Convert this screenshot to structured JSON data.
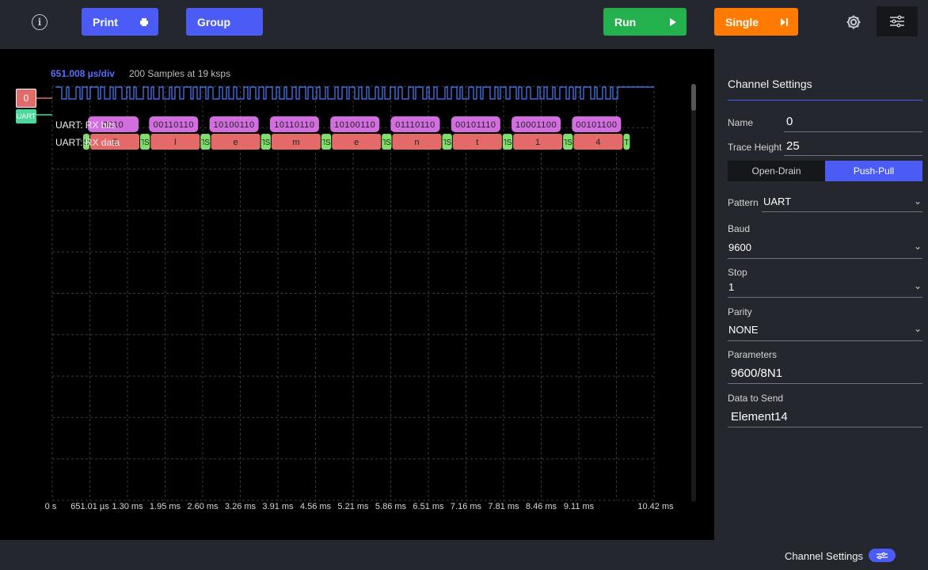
{
  "toolbar": {
    "print_label": "Print",
    "group_label": "Group",
    "run_label": "Run",
    "single_label": "Single",
    "info_glyph": "i",
    "colors": {
      "print": "#4a5cf5",
      "group": "#4a5cf5",
      "run": "#23b14d",
      "single": "#ff7a00"
    }
  },
  "scope": {
    "time_div": "651.008 µs/div",
    "samples": "200  Samples at 19 ksps",
    "channel_badge": "0",
    "uart_badge": "UART",
    "rx_bits_label": "UART: RX bits",
    "rx_data_label": "UART: RX data",
    "rx_bits_values": [
      "0010",
      "00110110",
      "10100110",
      "10110110",
      "10100110",
      "01110110",
      "00101110",
      "10001100",
      "00101100"
    ],
    "rx_data_frames": [
      {
        "start": "S",
        "char": "E",
        "stop": "T"
      },
      {
        "start": "S",
        "char": "l",
        "stop": "T"
      },
      {
        "start": "S",
        "char": "e",
        "stop": "T"
      },
      {
        "start": "S",
        "char": "m",
        "stop": "T"
      },
      {
        "start": "S",
        "char": "e",
        "stop": "T"
      },
      {
        "start": "S",
        "char": "n",
        "stop": "T"
      },
      {
        "start": "S",
        "char": "t",
        "stop": "T"
      },
      {
        "start": "S",
        "char": "1",
        "stop": "T"
      },
      {
        "start": "S",
        "char": "4",
        "stop": "T"
      }
    ],
    "x_ticks": [
      "0 s",
      "651.01 µs",
      "1.30 ms",
      "1.95 ms",
      "2.60 ms",
      "3.26 ms",
      "3.91 ms",
      "4.56 ms",
      "5.21 ms",
      "5.86 ms",
      "6.51 ms",
      "7.16 ms",
      "7.81 ms",
      "8.46 ms",
      "9.11 ms",
      "10.42 ms"
    ],
    "colors": {
      "time_div": "#5a6cff",
      "bits": "#d36ee0",
      "data": "#e46a6a",
      "startstop": "#7ee06a",
      "digital": "#4a7dff"
    }
  },
  "panel": {
    "title": "Channel Settings",
    "name_label": "Name",
    "name_value": "0",
    "trace_height_label": "Trace Height",
    "trace_height_value": "25",
    "drive_options": [
      "Open-Drain",
      "Push-Pull"
    ],
    "drive_selected": "Push-Pull",
    "pattern_label": "Pattern",
    "pattern_value": "UART",
    "baud_label": "Baud",
    "baud_value": "9600",
    "stop_label": "Stop",
    "stop_value": "1",
    "parity_label": "Parity",
    "parity_value": "NONE",
    "parameters_label": "Parameters",
    "parameters_value": "9600/8N1",
    "data_to_send_label": "Data to Send",
    "data_to_send_value": "Element14"
  },
  "bottombar": {
    "label": "Channel Settings"
  }
}
